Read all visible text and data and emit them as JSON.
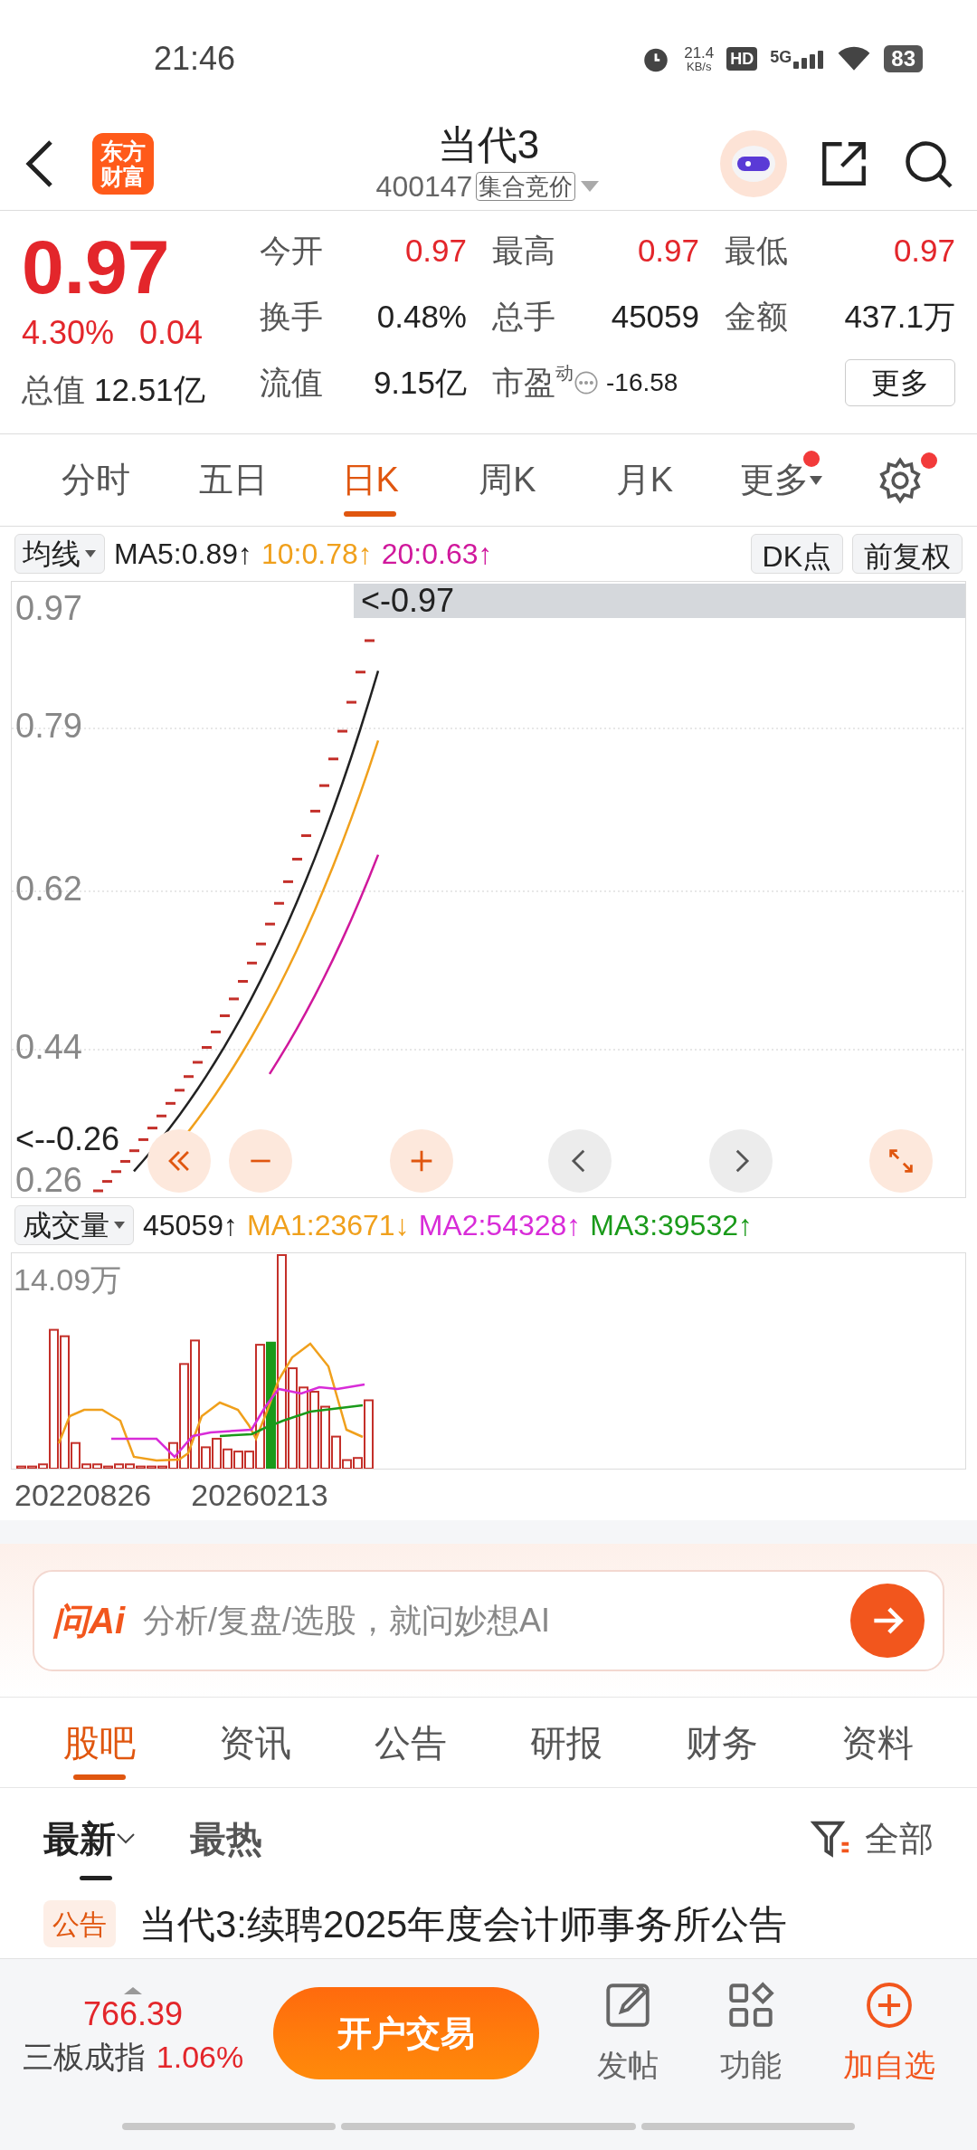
{
  "status_bar": {
    "time": "21:46",
    "net_speed": "21.4",
    "net_unit": "KB/s",
    "hd": "HD",
    "network": "5G",
    "battery": "83"
  },
  "header": {
    "logo_lines": [
      "东方",
      "财富"
    ],
    "title": "当代3",
    "code": "400147",
    "badge": "集合竞价"
  },
  "quote": {
    "price": "0.97",
    "change_pct": "4.30%",
    "change": "0.04",
    "rows": [
      [
        {
          "label": "今开",
          "value": "0.97",
          "kind": "up"
        },
        {
          "label": "最高",
          "value": "0.97",
          "kind": "up"
        },
        {
          "label": "最低",
          "value": "0.97",
          "kind": "up"
        }
      ],
      [
        {
          "label": "换手",
          "value": "0.48%",
          "kind": "flat"
        },
        {
          "label": "总手",
          "value": "45059",
          "kind": "flat"
        },
        {
          "label": "金额",
          "value": "437.1万",
          "kind": "flat"
        }
      ]
    ],
    "market_cap": {
      "label": "总值",
      "value": "12.51亿"
    },
    "float_cap": {
      "label": "流值",
      "value": "9.15亿"
    },
    "pe": {
      "label": "市盈",
      "sup": "动",
      "value": "-16.58"
    },
    "more_button": "更多"
  },
  "period_tabs": [
    {
      "label": "分时",
      "selected": false,
      "dot": false,
      "caret": false
    },
    {
      "label": "五日",
      "selected": false,
      "dot": false,
      "caret": false
    },
    {
      "label": "日K",
      "selected": true,
      "dot": false,
      "caret": false
    },
    {
      "label": "周K",
      "selected": false,
      "dot": false,
      "caret": false
    },
    {
      "label": "月K",
      "selected": false,
      "dot": false,
      "caret": false
    },
    {
      "label": "更多",
      "selected": false,
      "dot": true,
      "caret": true
    }
  ],
  "settings": {
    "dot": true
  },
  "ma_bar": {
    "selector": "均线",
    "items": [
      {
        "text": "MA5:0.89↑",
        "color": "#222222"
      },
      {
        "text": "10:0.78↑",
        "color": "#f0a01c"
      },
      {
        "text": "20:0.63↑",
        "color": "#d0189c"
      }
    ],
    "dk": "DK点",
    "adjust": "前复权"
  },
  "price_chart": {
    "y_labels": [
      "0.97",
      "0.79",
      "0.62",
      "0.44",
      "0.26"
    ],
    "high_marker": "<-0.97",
    "low_marker": "<--0.26"
  },
  "volume_bar": {
    "selector": "成交量",
    "value": "45059↑",
    "items": [
      {
        "text": "MA1:23671↓",
        "color": "#f0a01c"
      },
      {
        "text": "MA2:54328↑",
        "color": "#d82cd8"
      },
      {
        "text": "MA3:39532↑",
        "color": "#1a9a1a"
      }
    ]
  },
  "volume_chart": {
    "max_label": "14.09万",
    "dates": [
      "20220826",
      "20260213"
    ]
  },
  "ai_box": {
    "brand": "问Ai",
    "placeholder": "分析/复盘/选股，就问妙想AI"
  },
  "section_tabs": [
    {
      "label": "股吧",
      "selected": true
    },
    {
      "label": "资讯",
      "selected": false
    },
    {
      "label": "公告",
      "selected": false
    },
    {
      "label": "研报",
      "selected": false
    },
    {
      "label": "财务",
      "selected": false
    },
    {
      "label": "资料",
      "selected": false
    }
  ],
  "sort_tabs": [
    {
      "label": "最新",
      "selected": true
    },
    {
      "label": "最热",
      "selected": false
    }
  ],
  "filter": "全部",
  "posts": [
    {
      "tag": "公告",
      "title": "当代3:续聘2025年度会计师事务所公告"
    }
  ],
  "bottom_bar": {
    "index_value": "766.39",
    "index_name": "三板成指",
    "index_change": "1.06%",
    "trade_button": "开户交易",
    "actions": [
      {
        "label": "发帖",
        "kind": "post",
        "highlight": false
      },
      {
        "label": "功能",
        "kind": "apps",
        "highlight": false
      },
      {
        "label": "加自选",
        "kind": "add",
        "highlight": true
      }
    ]
  }
}
